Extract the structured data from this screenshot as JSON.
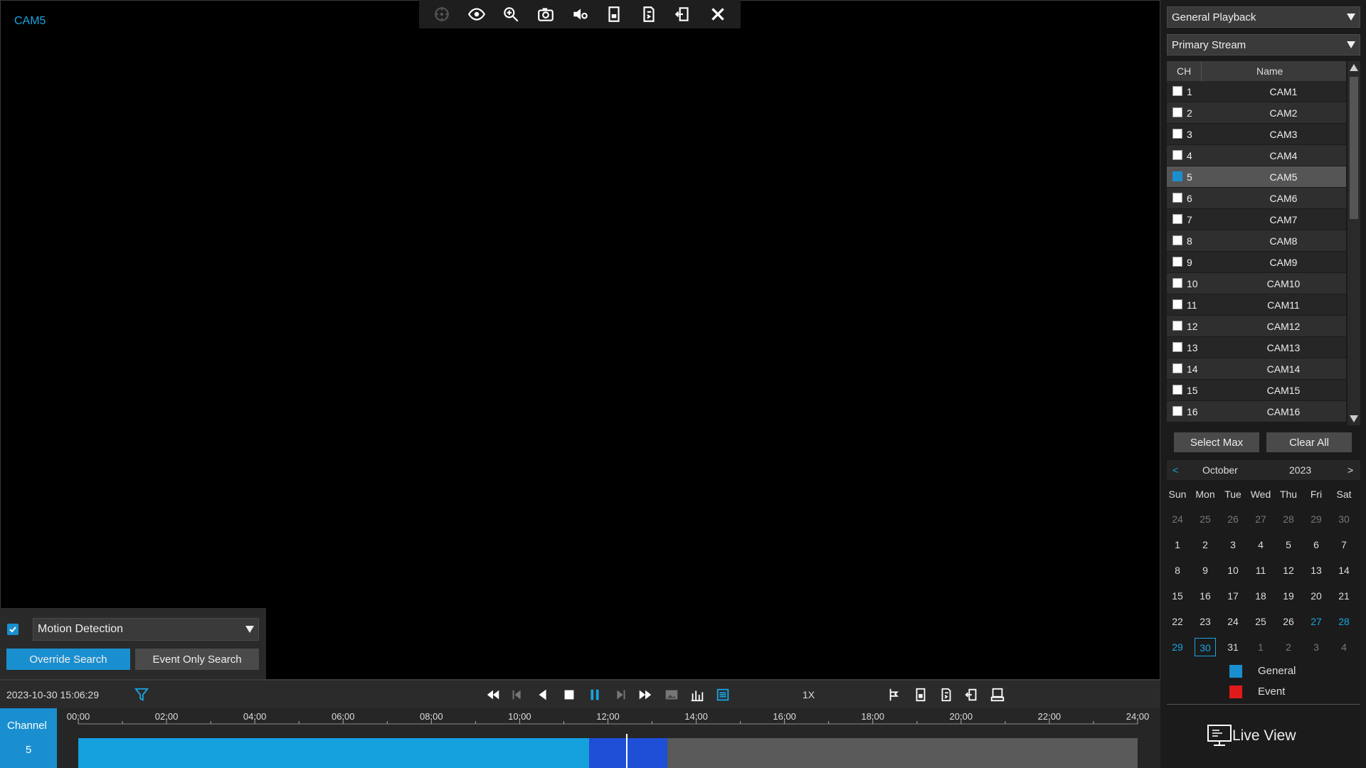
{
  "video": {
    "camera_label": "CAM5"
  },
  "toolbar": {
    "icons": [
      "ptz-icon",
      "eye-icon",
      "zoom-in-icon",
      "snapshot-icon",
      "audio-icon",
      "bookmark-icon",
      "clip-icon",
      "backup-icon",
      "close-icon"
    ]
  },
  "search_panel": {
    "event_type": "Motion Detection",
    "event_type_checked": true,
    "override_label": "Override Search",
    "event_only_label": "Event Only Search"
  },
  "control_bar": {
    "datetime": "2023-10-30 15:06:29",
    "speed": "1X"
  },
  "timeline": {
    "channel_title": "Channel",
    "channel_number": "5",
    "hour_labels": [
      "00:00",
      "02:00",
      "04:00",
      "06:00",
      "08:00",
      "10:00",
      "12:00",
      "14:00",
      "16:00",
      "18:00",
      "20:00",
      "22:00",
      "24:00"
    ],
    "general_recording_end_fraction": 0.502,
    "event_recording_start_fraction": 0.482,
    "event_recording_end_fraction": 0.556,
    "cursor_fraction": 0.517
  },
  "right_panel": {
    "playback_mode": "General Playback",
    "stream": "Primary Stream",
    "table_header": {
      "ch": "CH",
      "name": "Name"
    },
    "channels": [
      {
        "ch": "1",
        "name": "CAM1",
        "checked": false
      },
      {
        "ch": "2",
        "name": "CAM2",
        "checked": false
      },
      {
        "ch": "3",
        "name": "CAM3",
        "checked": false
      },
      {
        "ch": "4",
        "name": "CAM4",
        "checked": false
      },
      {
        "ch": "5",
        "name": "CAM5",
        "checked": true
      },
      {
        "ch": "6",
        "name": "CAM6",
        "checked": false
      },
      {
        "ch": "7",
        "name": "CAM7",
        "checked": false
      },
      {
        "ch": "8",
        "name": "CAM8",
        "checked": false
      },
      {
        "ch": "9",
        "name": "CAM9",
        "checked": false
      },
      {
        "ch": "10",
        "name": "CAM10",
        "checked": false
      },
      {
        "ch": "11",
        "name": "CAM11",
        "checked": false
      },
      {
        "ch": "12",
        "name": "CAM12",
        "checked": false
      },
      {
        "ch": "13",
        "name": "CAM13",
        "checked": false
      },
      {
        "ch": "14",
        "name": "CAM14",
        "checked": false
      },
      {
        "ch": "15",
        "name": "CAM15",
        "checked": false
      },
      {
        "ch": "16",
        "name": "CAM16",
        "checked": false
      }
    ],
    "select_max_label": "Select Max",
    "clear_all_label": "Clear All",
    "calendar": {
      "prev": "<",
      "month": "October",
      "year": "2023",
      "next": ">",
      "weekdays": [
        "Sun",
        "Mon",
        "Tue",
        "Wed",
        "Thu",
        "Fri",
        "Sat"
      ],
      "weeks": [
        [
          {
            "d": "24",
            "s": "other"
          },
          {
            "d": "25",
            "s": "other"
          },
          {
            "d": "26",
            "s": "other"
          },
          {
            "d": "27",
            "s": "other"
          },
          {
            "d": "28",
            "s": "other"
          },
          {
            "d": "29",
            "s": "other"
          },
          {
            "d": "30",
            "s": "other"
          }
        ],
        [
          {
            "d": "1",
            "s": ""
          },
          {
            "d": "2",
            "s": ""
          },
          {
            "d": "3",
            "s": ""
          },
          {
            "d": "4",
            "s": ""
          },
          {
            "d": "5",
            "s": ""
          },
          {
            "d": "6",
            "s": ""
          },
          {
            "d": "7",
            "s": ""
          }
        ],
        [
          {
            "d": "8",
            "s": ""
          },
          {
            "d": "9",
            "s": ""
          },
          {
            "d": "10",
            "s": ""
          },
          {
            "d": "11",
            "s": ""
          },
          {
            "d": "12",
            "s": ""
          },
          {
            "d": "13",
            "s": ""
          },
          {
            "d": "14",
            "s": ""
          }
        ],
        [
          {
            "d": "15",
            "s": ""
          },
          {
            "d": "16",
            "s": ""
          },
          {
            "d": "17",
            "s": ""
          },
          {
            "d": "18",
            "s": ""
          },
          {
            "d": "19",
            "s": ""
          },
          {
            "d": "20",
            "s": ""
          },
          {
            "d": "21",
            "s": ""
          }
        ],
        [
          {
            "d": "22",
            "s": ""
          },
          {
            "d": "23",
            "s": ""
          },
          {
            "d": "24",
            "s": ""
          },
          {
            "d": "25",
            "s": ""
          },
          {
            "d": "26",
            "s": ""
          },
          {
            "d": "27",
            "s": "rec"
          },
          {
            "d": "28",
            "s": "rec"
          }
        ],
        [
          {
            "d": "29",
            "s": "rec"
          },
          {
            "d": "30",
            "s": "rec today"
          },
          {
            "d": "31",
            "s": ""
          },
          {
            "d": "1",
            "s": "other"
          },
          {
            "d": "2",
            "s": "other"
          },
          {
            "d": "3",
            "s": "other"
          },
          {
            "d": "4",
            "s": "other"
          }
        ]
      ]
    },
    "legend": {
      "general": "General",
      "event": "Event",
      "general_color": "#1a8fd0",
      "event_color": "#e01a1a"
    },
    "live_view_label": "Live View"
  }
}
